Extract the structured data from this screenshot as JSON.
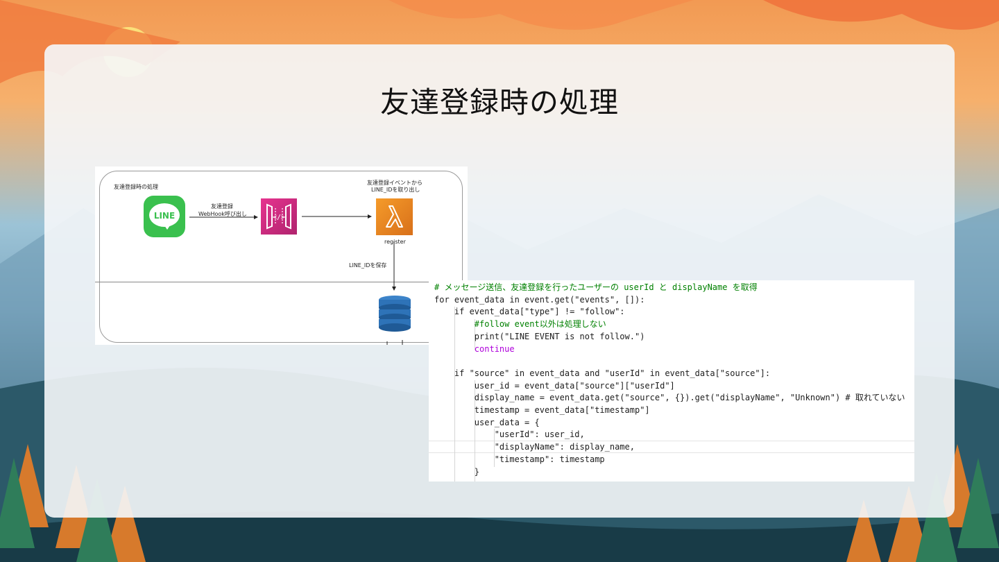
{
  "slide": {
    "title": "友達登録時の処理"
  },
  "diagram": {
    "frame_label": "友達登録時の処理",
    "line_icon_text": "LINE",
    "arrow1_label_line1": "友達登録",
    "arrow1_label_line2": "WebHook呼び出し",
    "lambda_label_line1": "友達登録イベントから",
    "lambda_label_line2": "LINE_IDを取り出し",
    "lambda_name": "register",
    "arrow2_label": "LINE_IDを保存"
  },
  "code": {
    "lines": [
      "# メッセージ送信、友達登録を行ったユーザーの userId と displayName を取得",
      "for event_data in event.get(\"events\", []):",
      "    if event_data[\"type\"] != \"follow\":",
      "        #follow event以外は処理しない",
      "        print(\"LINE EVENT is not follow.\")",
      "        continue",
      "",
      "    if \"source\" in event_data and \"userId\" in event_data[\"source\"]:",
      "        user_id = event_data[\"source\"][\"userId\"]",
      "        display_name = event_data.get(\"source\", {}).get(\"displayName\", \"Unknown\") # 取れていない",
      "        timestamp = event_data[\"timestamp\"]",
      "        user_data = {",
      "            \"userId\": user_id,",
      "            \"displayName\": display_name,",
      "            \"timestamp\": timestamp",
      "        }"
    ]
  },
  "colors": {
    "line_green": "#3ac04e",
    "api_gateway_pink": "#e6338f",
    "lambda_orange": "#f59b2a",
    "dynamodb_blue": "#2e73b8"
  }
}
